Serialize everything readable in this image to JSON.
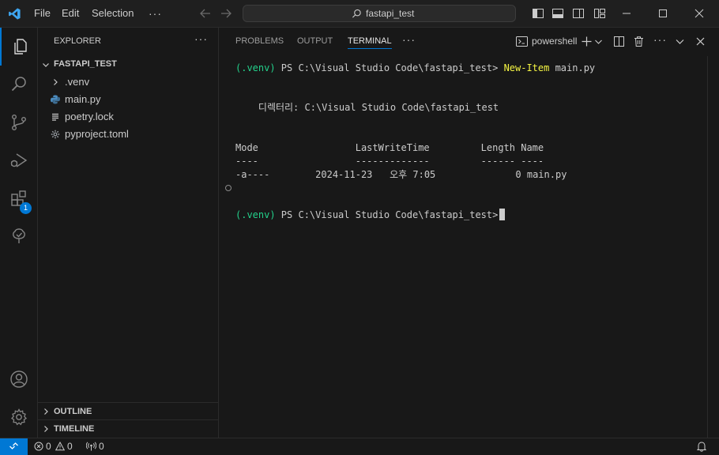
{
  "titlebar": {
    "menu": [
      "File",
      "Edit",
      "Selection"
    ],
    "more": "···",
    "search_text": "fastapi_test"
  },
  "activity": {
    "extensions_badge": "1"
  },
  "sidebar": {
    "title": "EXPLORER",
    "more": "···",
    "folder": "FASTAPI_TEST",
    "items": [
      {
        "label": ".venv",
        "icon": "chevron-right-icon"
      },
      {
        "label": "main.py",
        "icon": "python-icon"
      },
      {
        "label": "poetry.lock",
        "icon": "lines-icon"
      },
      {
        "label": "pyproject.toml",
        "icon": "gear-icon"
      }
    ],
    "outline": "OUTLINE",
    "timeline": "TIMELINE"
  },
  "panel": {
    "tabs": [
      "PROBLEMS",
      "OUTPUT",
      "TERMINAL"
    ],
    "active_tab": "TERMINAL",
    "more": "···",
    "shell": "powershell"
  },
  "terminal": {
    "prompt_env": "(.venv)",
    "prompt_path": " PS C:\\Visual Studio Code\\fastapi_test> ",
    "cmd_name": "New-Item",
    "cmd_arg": " main.py",
    "dir_line": "    디렉터리: C:\\Visual Studio Code\\fastapi_test",
    "header_line": "Mode                 LastWriteTime         Length Name",
    "dash_line": "----                 -------------         ------ ----",
    "row_line": "-a----        2024-11-23   오후 7:05              0 main.py",
    "prompt2_env": "(.venv)",
    "prompt2_path": " PS C:\\Visual Studio Code\\fastapi_test>"
  },
  "status": {
    "errors": "0",
    "warnings": "0",
    "ports": "0"
  },
  "colors": {
    "accent": "#0078d4",
    "terminal_green": "#23d18b",
    "terminal_yellow": "#f5f543"
  }
}
